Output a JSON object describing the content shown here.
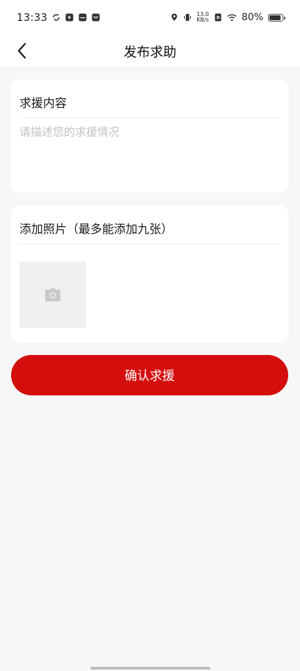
{
  "status_bar": {
    "time": "13:33",
    "net_speed_value": "13.0",
    "net_speed_unit": "KB/s",
    "battery_percent": "80%"
  },
  "nav": {
    "title": "发布求助"
  },
  "help_content": {
    "label": "求援内容",
    "placeholder": "请描述您的求援情况",
    "value": ""
  },
  "photos": {
    "label": "添加照片（最多能添加九张）",
    "slot_icon": "camera-icon"
  },
  "submit": {
    "label": "确认求援"
  },
  "colors": {
    "accent": "#d40d0d",
    "background": "#f7f7f7",
    "card": "#ffffff",
    "placeholder": "#c1c1c1"
  }
}
